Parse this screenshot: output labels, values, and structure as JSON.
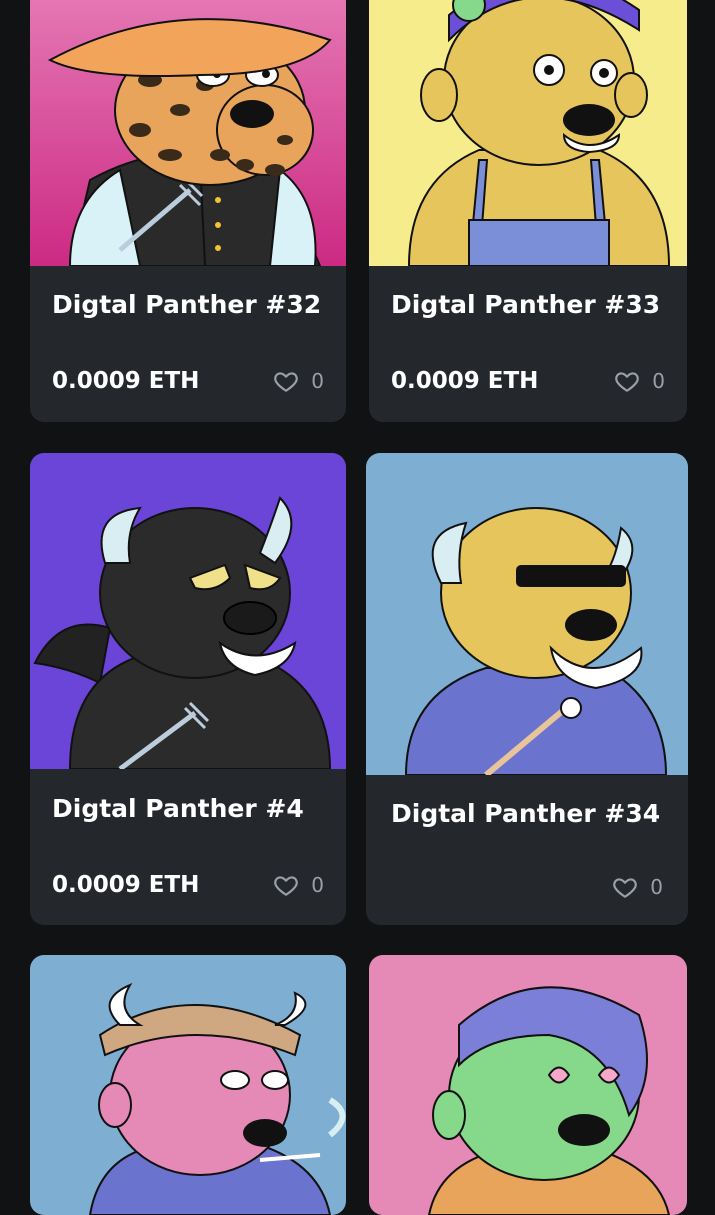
{
  "cards": [
    {
      "title": "Digtal Panther #32",
      "price": "0.0009 ETH",
      "likes": "0",
      "artwork": "panther-leopard-hat"
    },
    {
      "title": "Digtal Panther #33",
      "price": "0.0009 ETH",
      "likes": "0",
      "artwork": "panther-overalls"
    },
    {
      "title": "Digtal Panther #4",
      "price": "0.0009 ETH",
      "likes": "0",
      "artwork": "panther-devil"
    },
    {
      "title": "Digtal Panther #34",
      "price": "",
      "likes": "0",
      "artwork": "panther-sunglasses"
    },
    {
      "title": "",
      "price": "",
      "likes": "",
      "artwork": "panther-viking"
    },
    {
      "title": "",
      "price": "",
      "likes": "",
      "artwork": "panther-green-heart-glasses"
    }
  ],
  "icons": {
    "like": "heart-icon"
  },
  "colors": {
    "page_background": "#111213",
    "card_background": "#24282d",
    "text_primary": "#ffffff",
    "text_muted": "#9aa0a6"
  }
}
